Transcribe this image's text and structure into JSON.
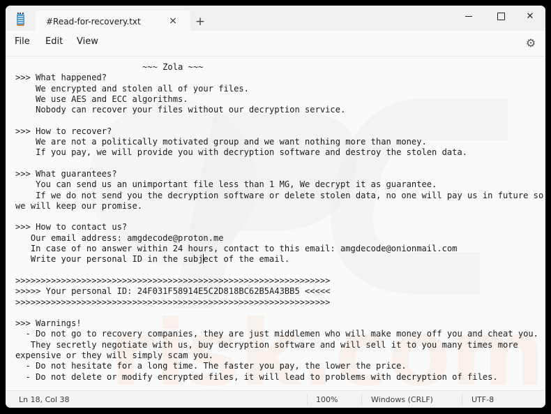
{
  "window": {
    "tab_title": "#Read-for-recovery.txt",
    "tab_close_icon": "×",
    "new_tab_icon": "+",
    "minimize_icon": "minimize-icon",
    "maximize_icon": "maximize-icon",
    "close_icon": "✕"
  },
  "menu": {
    "file": "File",
    "edit": "Edit",
    "view": "View",
    "settings_icon": "⚙"
  },
  "document": {
    "lines_before_caret": "                         ~~~ Zola ~~~\n>>> What happened?\n    We encrypted and stolen all of your files.\n    We use AES and ECC algorithms.\n    Nobody can recover your files without our decryption service.\n\n>>> How to recover?\n    We are not a politically motivated group and we want nothing more than money.\n    If you pay, we will provide you with decryption software and destroy the stolen data.\n\n>>> What guarantees?\n    You can send us an unimportant file less than 1 MG, We decrypt it as guarantee.\n    If we do not send you the decryption software or delete stolen data, no one will pay us in future so\nwe will keep our promise.\n\n>>> How to contact us?\n   Our email address: amgdecode@proton.me\n   In case of no answer within 24 hours, contact to this email: amgdecode@onionmail.com\n   Write your personal ID in the subj",
    "lines_after_caret": "ect of the email.\n\n>>>>>>>>>>>>>>>>>>>>>>>>>>>>>>>>>>>>>>>>>>>>>>>>>>>>>>>>>>>>>>\n>>>>> Your personal ID: 24F031F58914E5C2D818BC62B5A43BB5 <<<<<\n>>>>>>>>>>>>>>>>>>>>>>>>>>>>>>>>>>>>>>>>>>>>>>>>>>>>>>>>>>>>>>\n\n>>> Warnings!\n  - Do not go to recovery companies, they are just middlemen who will make money off you and cheat you.\n   They secretly negotiate with us, buy decryption software and will sell it to you many times more\nexpensive or they will simply scam you.\n  - Do not hesitate for a long time. The faster you pay, the lower the price.\n  - Do not delete or modify encrypted files, it will lead to problems with decryption of files."
  },
  "status": {
    "position": "Ln 18, Col 38",
    "zoom": "100%",
    "line_ending": "Windows (CRLF)",
    "encoding": "UTF-8"
  }
}
